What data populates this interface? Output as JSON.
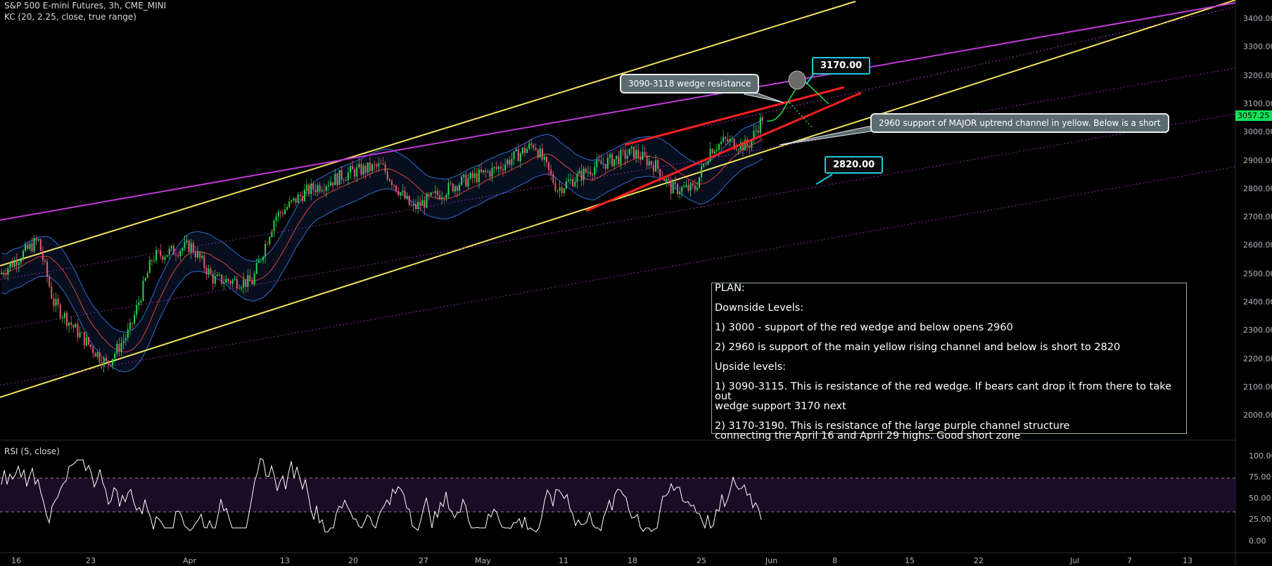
{
  "header": {
    "title": "S&P 500 E-mini Futures, 3h, CME_MINI",
    "indicator": "KC (20, 2.25, close, true range)",
    "rsi_title": "RSI (5, close)"
  },
  "price_axis": {
    "labels": [
      "3400.00",
      "3300.00",
      "3200.00",
      "3100.00",
      "3000.00",
      "2900.00",
      "2800.00",
      "2700.00",
      "2600.00",
      "2500.00",
      "2400.00",
      "2300.00",
      "2200.00",
      "2100.00",
      "2000.00"
    ],
    "current_price": "3057.25",
    "current_price_color": "#13e05a"
  },
  "rsi_axis": {
    "labels": [
      "100.00",
      "75.00",
      "50.00",
      "25.00",
      "0.00"
    ]
  },
  "time_axis": {
    "labels": [
      "16",
      "23",
      "Apr",
      "13",
      "20",
      "27",
      "May",
      "11",
      "18",
      "25",
      "Jun",
      "8",
      "15",
      "22",
      "Jul",
      "7",
      "13"
    ]
  },
  "annotations": {
    "wedge_resistance": "3090-3118 wedge resistance",
    "major_support": "2960 support of MAJOR uptrend channel in yellow. Below is a short",
    "target_up": "3170.00",
    "target_down": "2820.00"
  },
  "plan": {
    "title": "PLAN:",
    "downside_title": "Downside Levels:",
    "d1": "1) 3000 - support of the red wedge and below opens 2960",
    "d2": "2) 2960 is support of the main yellow rising channel and below is short to 2820",
    "upside_title": "Upside levels:",
    "u1a": "1) 3090-3115. This is resistance of the red wedge. If bears cant drop it from there to take out",
    "u1b": "wedge support 3170 next",
    "u2a": "2) 3170-3190. This is resistance of the large purple channel structure",
    "u2b": "connecting the April 16 and April 29 highs. Good short zone"
  },
  "colors": {
    "up_candle": "#26d64a",
    "down_candle": "#e8576f",
    "keltner": "#2e6fd1",
    "keltner_mid": "#d6433f",
    "yellow_channel": "#f2e35c",
    "purple_channel": "#c03ad8",
    "red_wedge": "#ff1f1f",
    "rsi_line": "#ffffff",
    "rsi_band": "#1c0b26"
  },
  "chart_data": {
    "type": "candlestick",
    "title": "S&P 500 E-mini Futures, 3h, CME_MINI",
    "ylim": [
      1950,
      3470
    ],
    "price_path": [
      [
        0,
        2500
      ],
      [
        0.05,
        2620
      ],
      [
        0.07,
        2400
      ],
      [
        0.1,
        2300
      ],
      [
        0.14,
        2180
      ],
      [
        0.17,
        2300
      ],
      [
        0.2,
        2560
      ],
      [
        0.25,
        2600
      ],
      [
        0.28,
        2480
      ],
      [
        0.33,
        2470
      ],
      [
        0.36,
        2700
      ],
      [
        0.4,
        2790
      ],
      [
        0.46,
        2860
      ],
      [
        0.5,
        2880
      ],
      [
        0.54,
        2730
      ],
      [
        0.6,
        2820
      ],
      [
        0.65,
        2870
      ],
      [
        0.7,
        2960
      ],
      [
        0.73,
        2800
      ],
      [
        0.78,
        2880
      ],
      [
        0.83,
        2930
      ],
      [
        0.86,
        2880
      ],
      [
        0.88,
        2800
      ],
      [
        0.91,
        2800
      ],
      [
        0.93,
        2940
      ],
      [
        0.95,
        2970
      ],
      [
        0.98,
        2950
      ],
      [
        1.0,
        3060
      ]
    ],
    "keltner_channel": {
      "period": 20,
      "multiplier": 2.25
    },
    "levels": {
      "wedge_resistance": [
        3090,
        3118
      ],
      "target_up": 3170,
      "major_support": 2960,
      "target_down": 2820
    },
    "rsi": {
      "period": 5,
      "overbought": 70,
      "oversold": 30,
      "ylim": [
        0,
        100
      ]
    }
  }
}
